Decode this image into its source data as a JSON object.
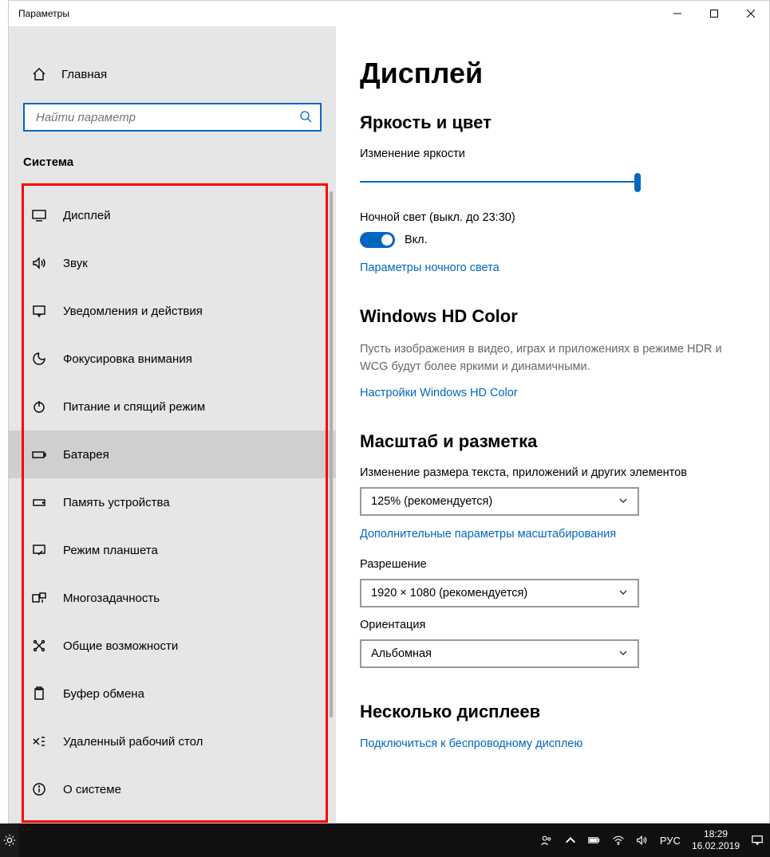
{
  "window": {
    "title": "Параметры"
  },
  "sidebar": {
    "home": "Главная",
    "search_placeholder": "Найти параметр",
    "category": "Система",
    "items": [
      {
        "label": "Дисплей"
      },
      {
        "label": "Звук"
      },
      {
        "label": "Уведомления и действия"
      },
      {
        "label": "Фокусировка внимания"
      },
      {
        "label": "Питание и спящий режим"
      },
      {
        "label": "Батарея"
      },
      {
        "label": "Память устройства"
      },
      {
        "label": "Режим планшета"
      },
      {
        "label": "Многозадачность"
      },
      {
        "label": "Общие возможности"
      },
      {
        "label": "Буфер обмена"
      },
      {
        "label": "Удаленный рабочий стол"
      },
      {
        "label": "О системе"
      }
    ]
  },
  "content": {
    "title": "Дисплей",
    "brightness_heading": "Яркость и цвет",
    "brightness_label": "Изменение яркости",
    "nightlight_label": "Ночной свет (выкл. до 23:30)",
    "toggle_on": "Вкл.",
    "nightlight_link": "Параметры ночного света",
    "hdcolor_heading": "Windows HD Color",
    "hdcolor_desc": "Пусть изображения в видео, играх и приложениях в режиме HDR и WCG будут более яркими и динамичными.",
    "hdcolor_link": "Настройки Windows HD Color",
    "scale_heading": "Масштаб и разметка",
    "scale_label": "Изменение размера текста, приложений и других элементов",
    "scale_value": "125% (рекомендуется)",
    "scale_link": "Дополнительные параметры масштабирования",
    "resolution_label": "Разрешение",
    "resolution_value": "1920 × 1080 (рекомендуется)",
    "orientation_label": "Ориентация",
    "orientation_value": "Альбомная",
    "multidisplay_heading": "Несколько дисплеев",
    "wireless_link": "Подключиться к беспроводному дисплею"
  },
  "taskbar": {
    "lang": "РУС",
    "time": "18:29",
    "date": "16.02.2019"
  }
}
